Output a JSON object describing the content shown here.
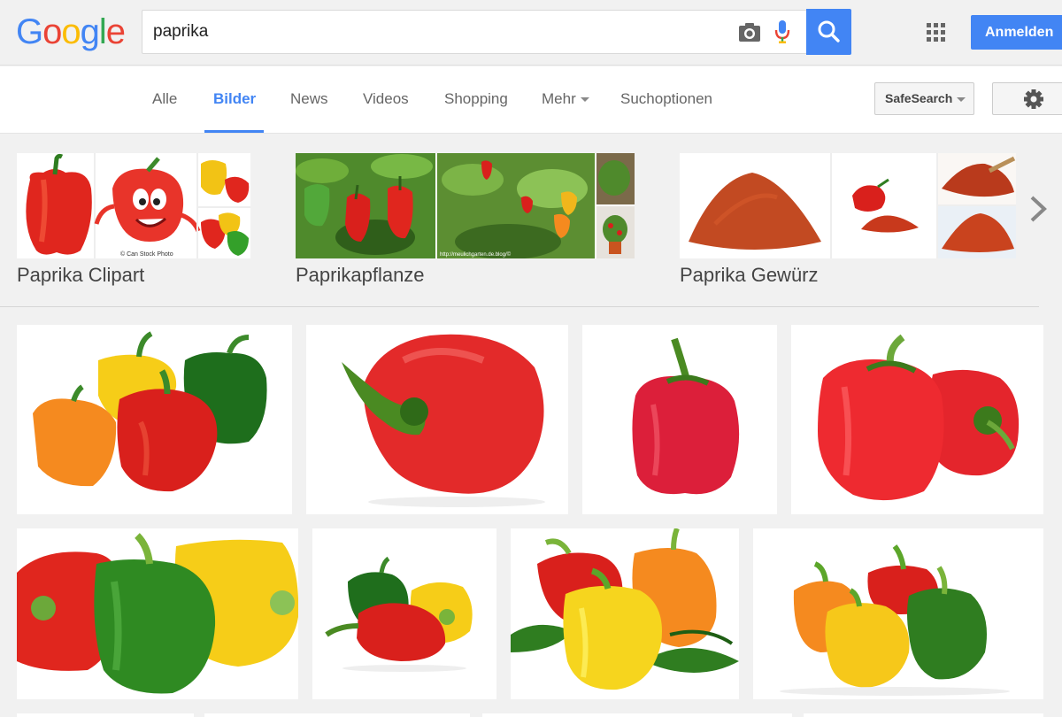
{
  "logo": {
    "text": "Google",
    "letters": [
      "G",
      "o",
      "o",
      "g",
      "l",
      "e"
    ],
    "colors": [
      "#4285f4",
      "#ea4335",
      "#fbbc05",
      "#4285f4",
      "#34a853",
      "#ea4335"
    ]
  },
  "search": {
    "query": "paprika",
    "camera_icon": "camera-icon",
    "mic_icon": "microphone-icon",
    "search_icon": "search-icon"
  },
  "header": {
    "apps_icon": "apps-grid-icon",
    "signin_label": "Anmelden"
  },
  "tabs": [
    {
      "label": "Alle"
    },
    {
      "label": "Bilder",
      "active": true
    },
    {
      "label": "News"
    },
    {
      "label": "Videos"
    },
    {
      "label": "Shopping"
    },
    {
      "label": "Mehr"
    },
    {
      "label": "Suchoptionen"
    }
  ],
  "toolbar": {
    "safesearch_label": "SafeSearch",
    "settings_icon": "gear-icon"
  },
  "related": [
    {
      "label": "Paprika Clipart",
      "caption": "© Can Stock Photo"
    },
    {
      "label": "Paprikapflanze",
      "caption": "http://meulichgarten.de.blog/©"
    },
    {
      "label": "Paprika Gewürz"
    }
  ],
  "colors": {
    "accent": "#4285f4",
    "pepper_red": "#e8242b",
    "pepper_yellow": "#f6cd18",
    "pepper_orange": "#f58a1f",
    "pepper_green": "#2f7d20",
    "paprika_powder": "#c24a22"
  }
}
